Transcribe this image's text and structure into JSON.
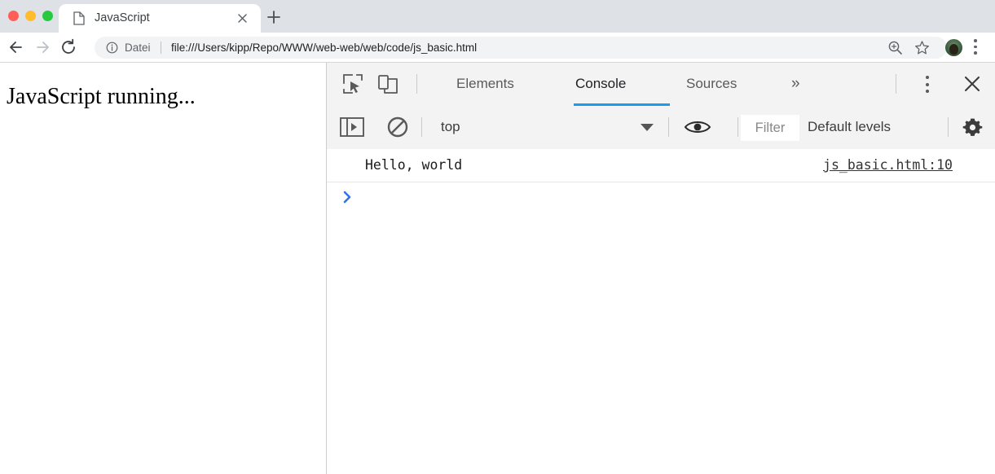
{
  "window": {
    "traffic_lights": [
      {
        "name": "close",
        "color": "#ff5f56"
      },
      {
        "name": "minimize",
        "color": "#ffbd2e"
      },
      {
        "name": "zoom",
        "color": "#27c93f"
      }
    ]
  },
  "tabstrip": {
    "tab": {
      "title": "JavaScript",
      "favicon": "page-icon",
      "close_label": "×"
    },
    "new_tab_label": "+"
  },
  "toolbar": {
    "back_icon": "arrow-left-icon",
    "forward_icon": "arrow-right-icon",
    "reload_icon": "reload-icon",
    "omnibox": {
      "info_icon": "info-circle-icon",
      "scheme_label": "Datei",
      "url": "file:///Users/kipp/Repo/WWW/web-web/web/code/js_basic.html"
    },
    "zoom_icon": "zoom-in-icon",
    "bookmark_icon": "star-icon",
    "avatar": "profile-avatar",
    "menu_icon": "three-dot-menu-icon"
  },
  "page": {
    "body_text": "JavaScript running..."
  },
  "devtools": {
    "inspect_icon": "inspect-element-icon",
    "device_icon": "device-toolbar-icon",
    "tabs": [
      {
        "label": "Elements",
        "active": false
      },
      {
        "label": "Console",
        "active": true
      },
      {
        "label": "Sources",
        "active": false
      }
    ],
    "more_tabs_label": "»",
    "menu_icon": "three-dot-menu-icon",
    "close_icon": "close-icon",
    "accent_color": "#1a9bf0",
    "filterbar": {
      "sidebar_icon": "console-sidebar-toggle-icon",
      "clear_icon": "clear-console-icon",
      "context": "top",
      "context_caret": "chevron-down-icon",
      "eye_icon": "live-expression-eye-icon",
      "filter_placeholder": "Filter",
      "levels_label": "Default levels",
      "settings_icon": "gear-icon"
    },
    "console": {
      "messages": [
        {
          "text": "Hello, world",
          "source": "js_basic.html:10"
        }
      ],
      "prompt_icon": "prompt-chevron-icon",
      "prompt_color": "#3173e8",
      "prompt_value": ""
    }
  }
}
